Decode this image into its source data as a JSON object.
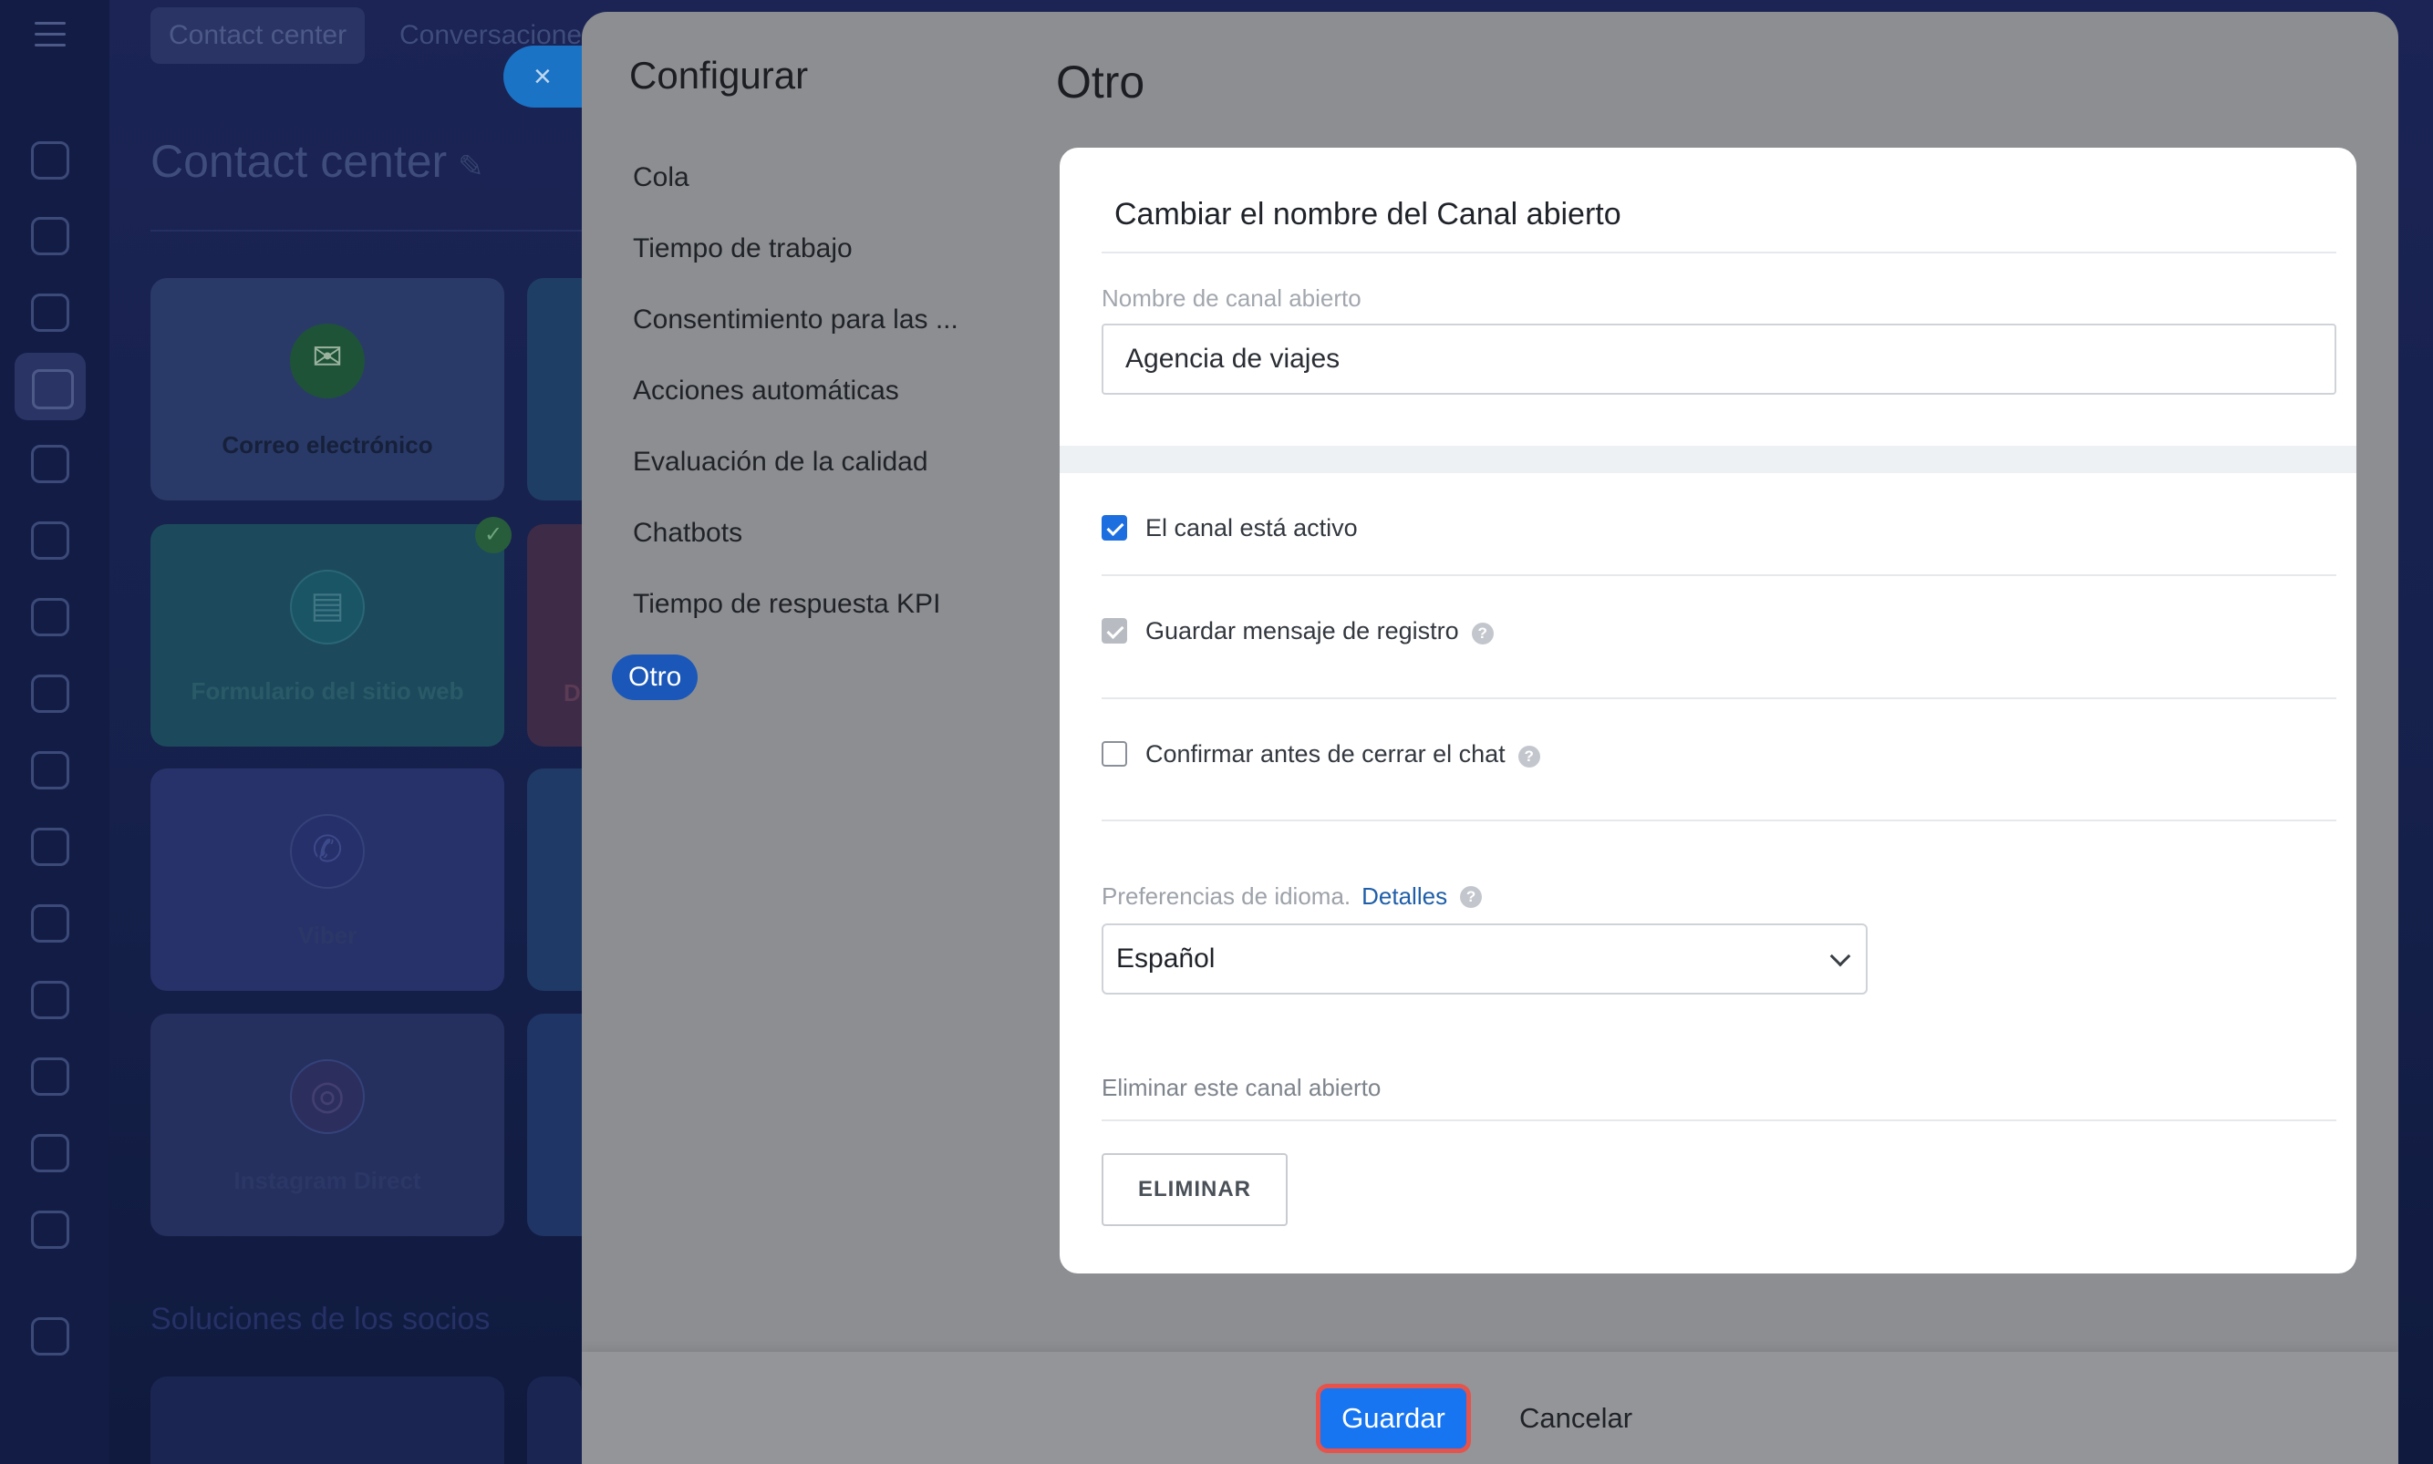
{
  "background": {
    "top_tabs": [
      "Contact center",
      "Conversacione"
    ],
    "page_title": "Contact center",
    "tiles": [
      {
        "label": "Correo electrónico",
        "icon": "envelope-icon"
      },
      {
        "label": "Formulario del sitio web",
        "icon": "form-icon"
      },
      {
        "label": "Viber",
        "icon": "viber-icon"
      },
      {
        "label": "Instagram Direct",
        "icon": "instagram-icon"
      }
    ],
    "partial_tile_letter": "D",
    "partners_title": "Soluciones de los socios",
    "close_icon": "×"
  },
  "panel": {
    "nav_title": "Configurar",
    "nav_items": [
      "Cola",
      "Tiempo de trabajo",
      "Consentimiento para las ...",
      "Acciones automáticas",
      "Evaluación de la calidad",
      "Chatbots",
      "Tiempo de respuesta KPI",
      "Otro"
    ],
    "active_nav": "Otro",
    "heading": "Otro",
    "card": {
      "title": "Cambiar el nombre del Canal abierto",
      "name_label": "Nombre de canal abierto",
      "name_value": "Agencia de viajes",
      "checkboxes": [
        {
          "label": "El canal está activo",
          "checked": true,
          "help": false
        },
        {
          "label": "Guardar mensaje de registro",
          "checked": true,
          "disabled": true,
          "help": true
        },
        {
          "label": "Confirmar antes de cerrar el chat",
          "checked": false,
          "help": true
        }
      ],
      "help_glyph": "?",
      "language_label": "Preferencias de idioma.",
      "language_link": "Detalles",
      "language_value": "Español",
      "delete_label": "Eliminar este canal abierto",
      "delete_button": "ELIMINAR"
    },
    "footer": {
      "save": "Guardar",
      "cancel": "Cancelar"
    }
  },
  "colors": {
    "primary": "#1775f2",
    "highlight_outline": "#e5534b",
    "active_nav": "#1a57b8",
    "link": "#1f5ea8"
  }
}
